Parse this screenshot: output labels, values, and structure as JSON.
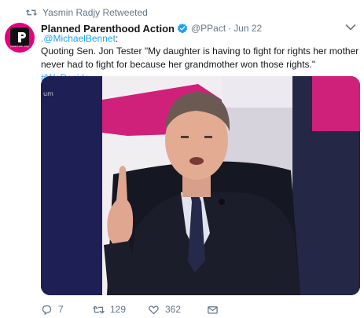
{
  "retweet_context": {
    "text": "Yasmin Radjy Retweeted",
    "icon": "retweet-icon"
  },
  "author": {
    "display_name": "Planned Parenthood Action",
    "verified": true,
    "handle": "@PPact",
    "separator": "·",
    "timestamp": "Jun 22",
    "avatar_caption": "ppaction.org",
    "brand_color": "#e5007e"
  },
  "tweet": {
    "mention_prefix": ".",
    "mention": "@MichaelBennet",
    "mention_suffix": ":",
    "text": "Quoting Sen. Jon Tester \"My daughter is having to fight for rights her mother never had to fight for because her grandmother won those rights.\"",
    "hashtag": "#WeDecide"
  },
  "media": {
    "sign_text": "um",
    "icon": "video-still"
  },
  "actions": {
    "replies": "7",
    "retweets": "129",
    "likes": "362",
    "reply_icon": "reply-icon",
    "retweet_icon": "retweet-icon",
    "like_icon": "heart-icon",
    "dm_icon": "envelope-icon"
  },
  "colors": {
    "link": "#1da1f2",
    "muted": "#657786",
    "text": "#14171a"
  }
}
